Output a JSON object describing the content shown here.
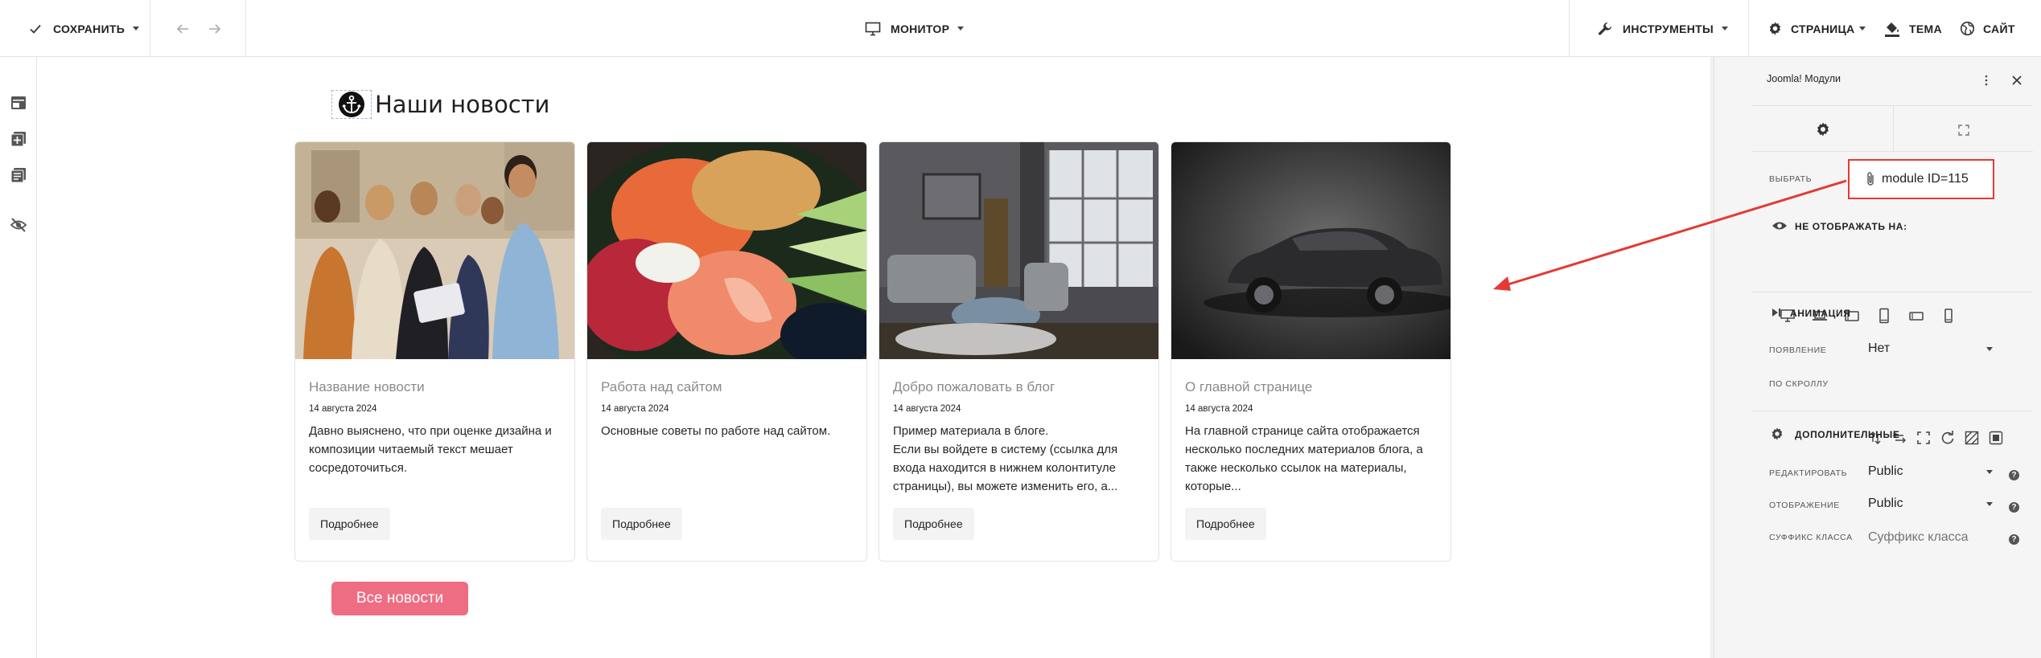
{
  "toolbar": {
    "save_label": "СОХРАНИТЬ",
    "monitor_label": "МОНИТОР",
    "tools_label": "ИНСТРУМЕНТЫ",
    "page_label": "СТРАНИЦА",
    "theme_label": "ТЕМА",
    "site_label": "САЙТ"
  },
  "content": {
    "heading": "Наши новости",
    "all_news_label": "Все новости",
    "cards": [
      {
        "title": "Название новости",
        "date": "14 августа 2024",
        "text": "Давно выяснено, что при оценке дизайна и композиции читаемый текст мешает сосредоточиться.",
        "button": "Подробнее",
        "image": "people-with-tablet-photo"
      },
      {
        "title": "Работа над сайтом",
        "date": "14 августа 2024",
        "text": "Основные советы по работе над сайтом.",
        "button": "Подробнее",
        "image": "sushi-photo"
      },
      {
        "title": "Добро пожаловать в блог",
        "date": "14 августа 2024",
        "text": "Пример материала в блоге.\nЕсли вы войдете в систему (ссылка для входа находится в нижнем колонтитуле страницы), вы можете изменить его, а...",
        "button": "Подробнее",
        "image": "living-room-photo"
      },
      {
        "title": "О главной странице",
        "date": "14 августа 2024",
        "text": "На главной странице сайта отображается несколько последних материалов блога, а также несколько ссылок на материалы, которые...",
        "button": "Подробнее",
        "image": "car-photo"
      }
    ]
  },
  "panel": {
    "title": "Joomla! Модули",
    "select_label": "ВЫБРАТЬ",
    "module_value": "module ID=115",
    "hide_on_label": "НЕ ОТОБРАЖАТЬ НА:",
    "animation_label": "АНИМАЦИЯ",
    "appearance_label": "ПОЯВЛЕНИЕ",
    "appearance_value": "Нет",
    "on_scroll_label": "ПО СКРОЛЛУ",
    "additional_label": "ДОПОЛНИТЕЛЬНЫЕ",
    "edit_label": "РЕДАКТИРОВАТЬ",
    "edit_value": "Public",
    "display_label": "ОТОБРАЖЕНИЕ",
    "display_value": "Public",
    "class_suffix_label": "СУФФИКС КЛАССА",
    "class_suffix_placeholder": "Суффикс класса",
    "help_glyph": "?"
  },
  "colors": {
    "accent": "#ef6d82",
    "annotation": "#e23b35"
  }
}
